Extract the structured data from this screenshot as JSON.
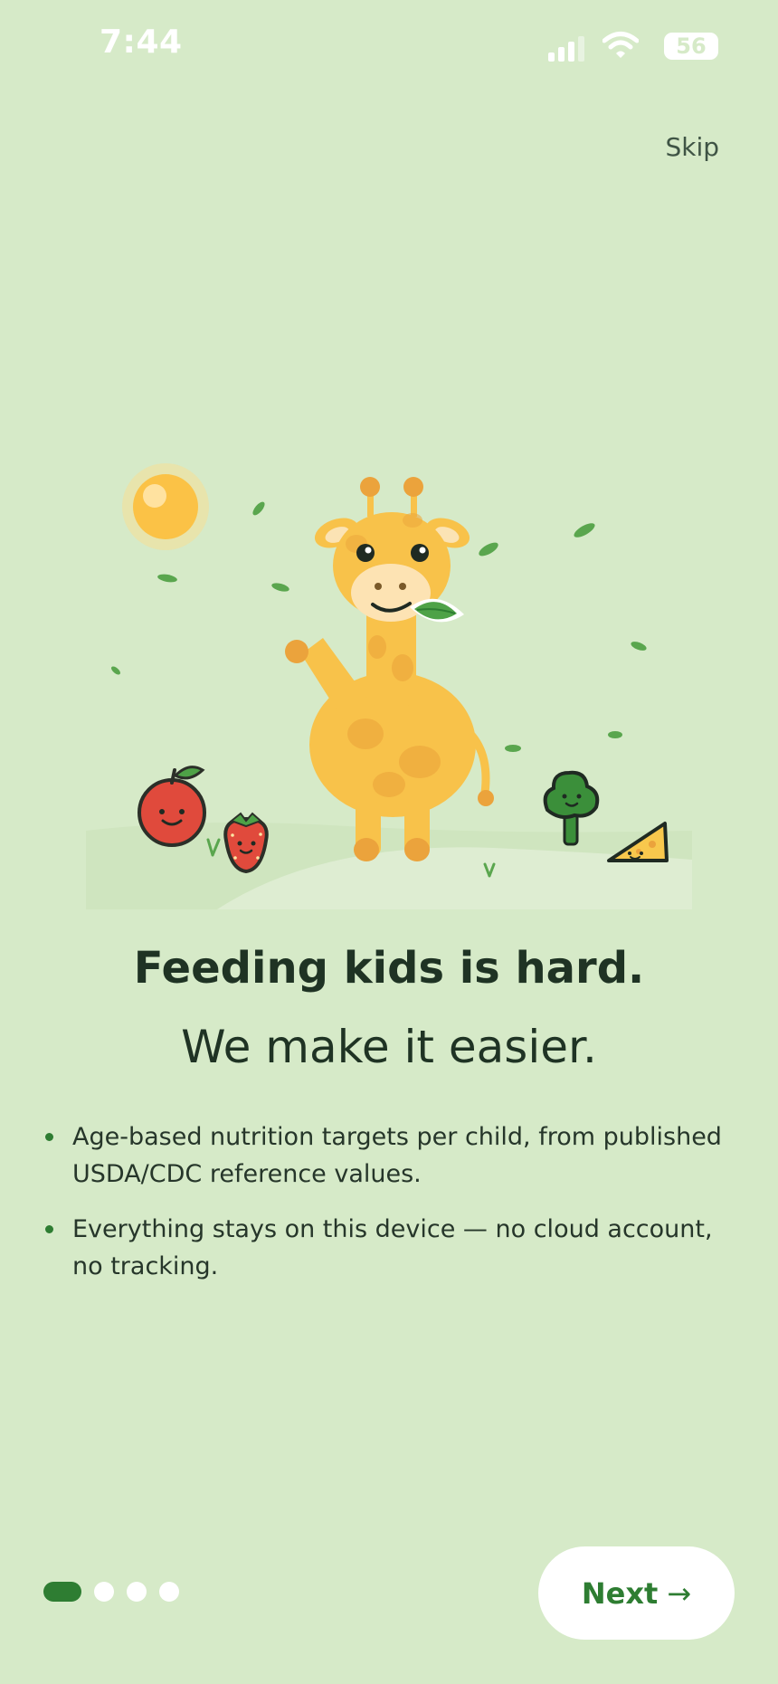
{
  "status_bar": {
    "time": "7:44",
    "battery": "56",
    "icons": [
      "signal-icon",
      "wifi-icon",
      "battery-icon"
    ]
  },
  "skip_label": "Skip",
  "illustration": {
    "subject": "giraffe eating a leaf with apple, strawberry, broccoli and cheese",
    "icons": [
      "sun-icon",
      "giraffe-icon",
      "apple-icon",
      "strawberry-icon",
      "broccoli-icon",
      "cheese-icon",
      "leaf-icon"
    ]
  },
  "headline": "Feeding kids is hard.",
  "subheadline": "We make it easier.",
  "bullets": [
    "Age-based nutrition targets per child, from published USDA/CDC reference values.",
    "Everything stays on this device — no cloud account, no tracking."
  ],
  "pager": {
    "current": 1,
    "total": 4
  },
  "next_button": {
    "label": "Next",
    "arrow": "→"
  },
  "colors": {
    "background": "#d6eac8",
    "accent": "#2e7d32",
    "text": "#1f3324",
    "giraffe": "#f8c24a"
  }
}
